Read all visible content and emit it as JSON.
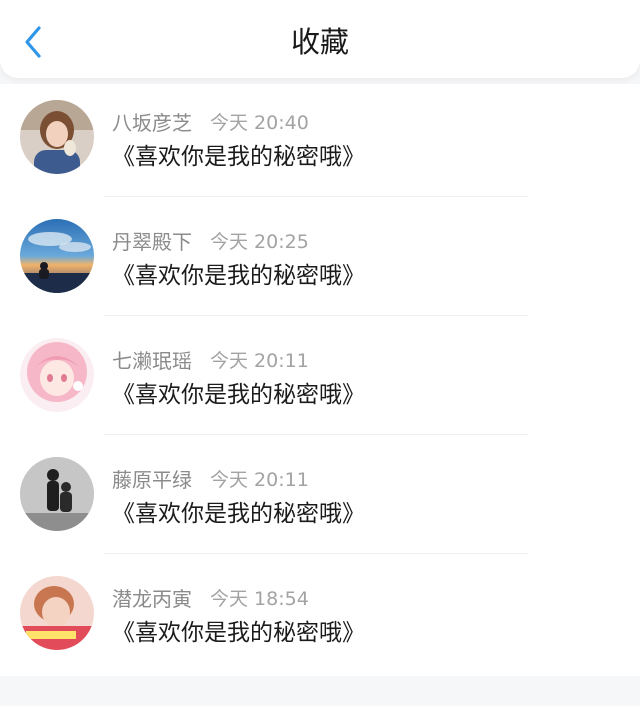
{
  "header": {
    "title": "收藏",
    "back_icon": "chevron-left-icon",
    "accent_color": "#2f96e8"
  },
  "favorites": [
    {
      "name": "八坂彦芝",
      "time": "今天 20:40",
      "content": "《喜欢你是我的秘密哦》",
      "avatar": "girl-photo-avatar"
    },
    {
      "name": "丹翠殿下",
      "time": "今天 20:25",
      "content": "《喜欢你是我的秘密哦》",
      "avatar": "sunset-photo-avatar"
    },
    {
      "name": "七濑珉瑶",
      "time": "今天 20:11",
      "content": "《喜欢你是我的秘密哦》",
      "avatar": "anime-girl-avatar"
    },
    {
      "name": "藤原平绿",
      "time": "今天 20:11",
      "content": "《喜欢你是我的秘密哦》",
      "avatar": "couple-silhouette-avatar"
    },
    {
      "name": "潜龙丙寅",
      "time": "今天 18:54",
      "content": "《喜欢你是我的秘密哦》",
      "avatar": "boy-photo-avatar"
    }
  ]
}
